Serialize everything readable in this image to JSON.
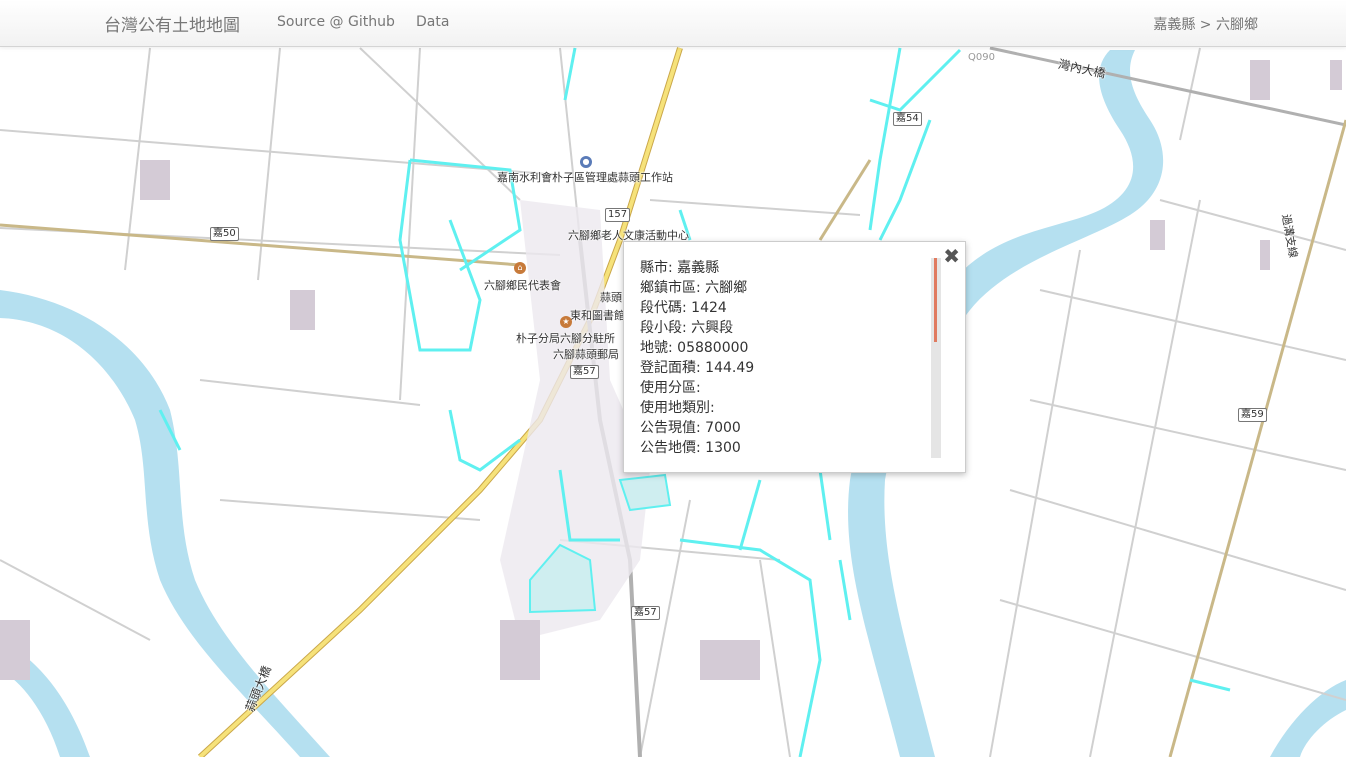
{
  "navbar": {
    "brand": "台灣公有土地地圖",
    "links": [
      "Source @ Github",
      "Data"
    ],
    "breadcrumb": "嘉義縣 > 六腳鄉"
  },
  "map": {
    "labels": [
      "嘉南水利會朴子區管理處蒜頭工作站",
      "六腳鄉老人文康活動中心",
      "六腳鄉民代表會",
      "蒜頭",
      "東和圖書館",
      "朴子分局六腳分駐所",
      "六腳蒜頭郵局",
      "灣內大橋",
      "過溝支線",
      "蒜頭大橋"
    ],
    "shields": [
      "嘉50",
      "157",
      "嘉57",
      "嘉57",
      "嘉54",
      "嘉59",
      "Q090"
    ],
    "colors": {
      "water": "#b5e0f0",
      "canal": "#5ff0f0",
      "road_main": "#f6e27a",
      "road_minor": "#d8d8d8",
      "land": "#ffffff"
    }
  },
  "popup": {
    "close_icon": "close-icon",
    "rows": [
      "縣市: 嘉義縣",
      "鄉鎮市區: 六腳鄉",
      "段代碼: 1424",
      "段小段: 六興段",
      "地號: 05880000",
      "登記面積: 144.49",
      "使用分區:",
      "使用地類別:",
      "公告現值: 7000",
      "公告地價: 1300"
    ]
  }
}
